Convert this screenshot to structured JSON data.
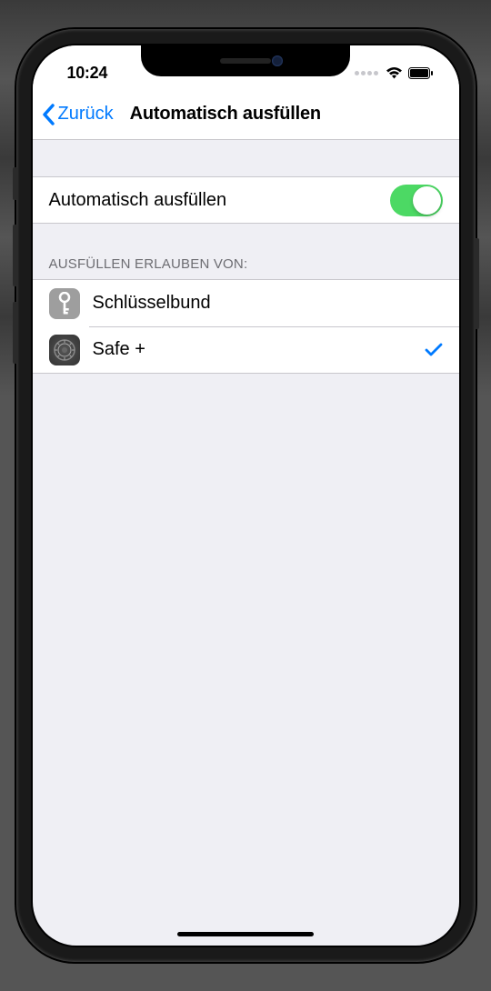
{
  "status": {
    "time": "10:24"
  },
  "nav": {
    "back_label": "Zurück",
    "title": "Automatisch ausfüllen"
  },
  "autofill": {
    "toggle_label": "Automatisch ausfüllen",
    "enabled": true
  },
  "providers": {
    "header": "Ausfüllen erlauben von:",
    "items": [
      {
        "label": "Schlüsselbund",
        "icon": "key-icon",
        "selected": false
      },
      {
        "label": "Safe +",
        "icon": "safe-icon",
        "selected": true
      }
    ]
  }
}
